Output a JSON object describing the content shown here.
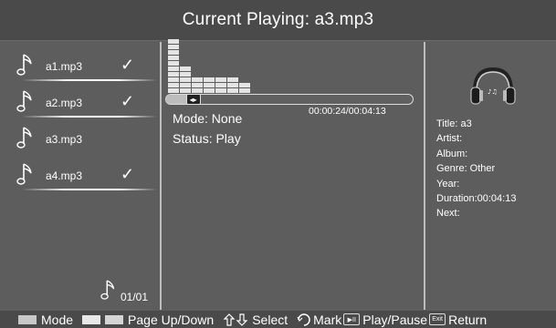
{
  "header": {
    "title": "Current Playing: a3.mp3"
  },
  "playlist": {
    "items": [
      {
        "name": "a1.mp3",
        "marked": true,
        "mark": "✓"
      },
      {
        "name": "a2.mp3",
        "marked": true,
        "mark": "✓"
      },
      {
        "name": "a3.mp3",
        "marked": false,
        "mark": ""
      },
      {
        "name": "a4.mp3",
        "marked": true,
        "mark": "✓"
      }
    ],
    "page": "01/01"
  },
  "player": {
    "elapsed_time": "00:00:24/00:04:13",
    "progress": 0.095,
    "mode_text": "Mode: None",
    "status_text": "Status: Play",
    "equalizer_levels": [
      10,
      5,
      3,
      3,
      3,
      3,
      2
    ]
  },
  "info": {
    "title": "Title: a3",
    "artist": "Artist:",
    "album": "Album:",
    "genre": "Genre: Other",
    "year": "Year:",
    "duration": "Duration:00:04:13",
    "next": "Next:"
  },
  "footer": {
    "mode_label": "Mode",
    "page_label": "Page Up/Down",
    "select_label": "Select",
    "mark_label": "Mark",
    "play_label": "Play/Pause",
    "exit_key": "Exit",
    "return_label": "Return",
    "red": "#c8c8c8",
    "green": "#e8e8e8",
    "yellow": "#d4d4d4"
  },
  "icons": {
    "song": "music-note-icon",
    "cover": "headphones-icon",
    "navigate": "arrow-cross-icon",
    "mark": "enter-icon",
    "play_pause": "play-pause-icon",
    "exit": "exit-icon"
  }
}
